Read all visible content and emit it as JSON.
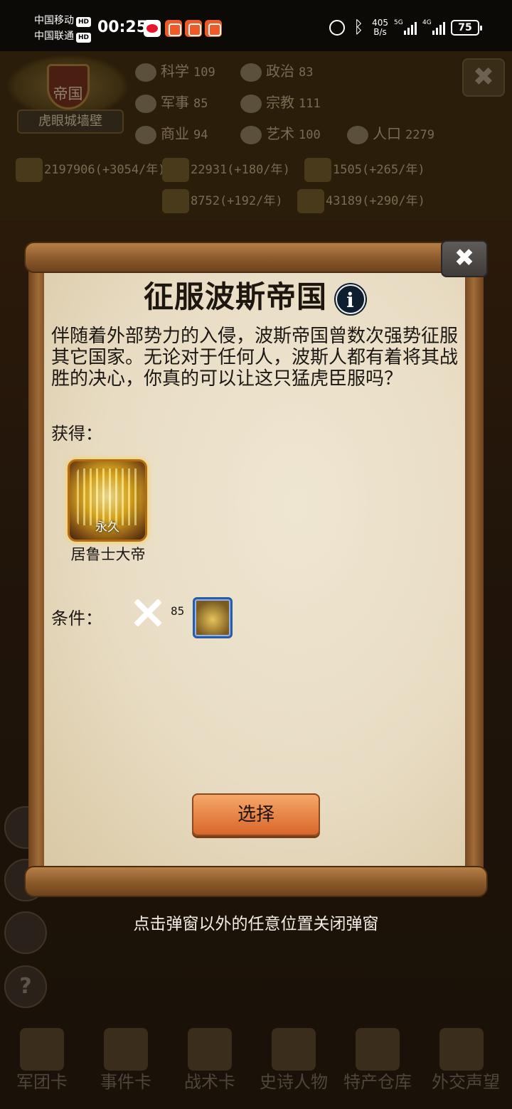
{
  "status_bar": {
    "carrier1": "中国移动",
    "carrier2": "中国联通",
    "hd_badge": "HD",
    "time": "00:25",
    "net_speed_value": "405",
    "net_speed_unit": "B/s",
    "signal1_label": "5G",
    "signal2_label": "4G",
    "battery": "75"
  },
  "hud": {
    "nation_title": "帝国",
    "city_name": "虎眼城墙壁",
    "stats": [
      {
        "label": "科学",
        "value": "109"
      },
      {
        "label": "政治",
        "value": "83"
      },
      {
        "label": "军事",
        "value": "85"
      },
      {
        "label": "宗教",
        "value": "111"
      },
      {
        "label": "商业",
        "value": "94"
      },
      {
        "label": "艺术",
        "value": "100"
      },
      {
        "label": "人口",
        "value": "2279"
      }
    ],
    "resources": [
      {
        "text": "2197906(+3054/年)"
      },
      {
        "text": "22931(+180/年)"
      },
      {
        "text": "1505(+265/年)"
      },
      {
        "text": "8752(+192/年)"
      },
      {
        "text": "43189(+290/年)"
      }
    ],
    "close_symbol": "✖"
  },
  "dialog": {
    "title": "征服波斯帝国",
    "info_symbol": "i",
    "close_symbol": "✖",
    "description": "伴随着外部势力的入侵，波斯帝国曾数次强势征服其它国家。无论对于任何人，波斯人都有着将其战胜的决心，你真的可以让这只猛虎臣服吗？",
    "gain_label": "获得：",
    "reward": {
      "badge": "永久",
      "name": "居鲁士大帝"
    },
    "condition_label": "条件：",
    "condition_value": "85",
    "select_label": "选择"
  },
  "dismiss_hint": "点击弹窗以外的任意位置关闭弹窗",
  "bottom_nav": [
    {
      "label": "军团卡"
    },
    {
      "label": "事件卡"
    },
    {
      "label": "战术卡"
    },
    {
      "label": "史诗人物"
    },
    {
      "label": "特产仓库"
    },
    {
      "label": "外交声望"
    }
  ]
}
